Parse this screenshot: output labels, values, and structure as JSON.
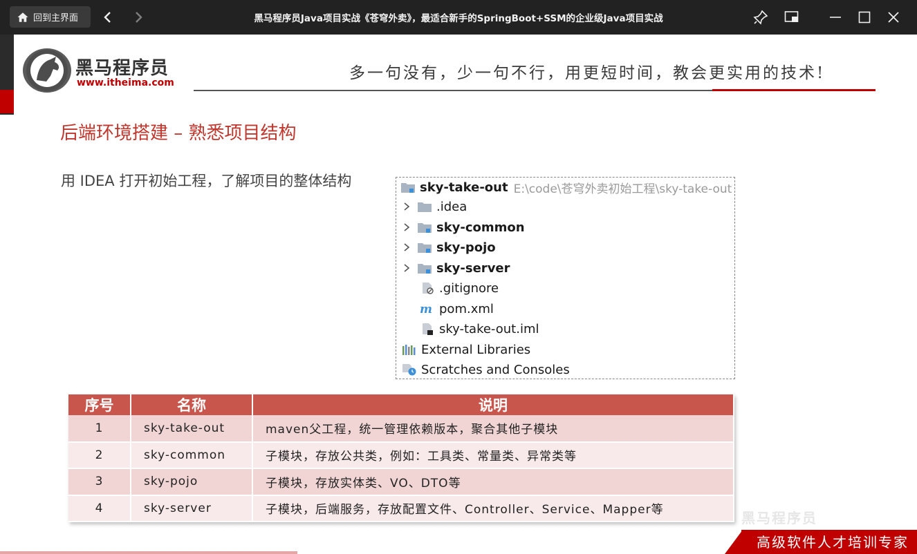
{
  "titlebar": {
    "home_label": "回到主界面",
    "title": "黑马程序员Java项目实战《苍穹外卖》，最适合新手的SpringBoot+SSM的企业级Java项目实战"
  },
  "slide": {
    "logo_cn": "黑马程序员",
    "logo_url": "www.itheima.com",
    "slogan": "多一句没有，少一句不行，用更短时间，教会更实用的技术!",
    "heading": "后端环境搭建 – 熟悉项目结构",
    "intro": "用 IDEA 打开初始工程，了解项目的整体结构",
    "tree": {
      "root_name": "sky-take-out",
      "root_path": "E:\\code\\苍穹外卖初始工程\\sky-take-out",
      "items": [
        {
          "label": ".idea"
        },
        {
          "label": "sky-common"
        },
        {
          "label": "sky-pojo"
        },
        {
          "label": "sky-server"
        },
        {
          "label": ".gitignore"
        },
        {
          "label": "pom.xml"
        },
        {
          "label": "sky-take-out.iml"
        },
        {
          "label": "External Libraries"
        },
        {
          "label": "Scratches and Consoles"
        }
      ]
    },
    "table": {
      "headers": [
        "序号",
        "名称",
        "说明"
      ],
      "rows": [
        [
          "1",
          "sky-take-out",
          "maven父工程，统一管理依赖版本，聚合其他子模块"
        ],
        [
          "2",
          "sky-common",
          "子模块，存放公共类，例如：工具类、常量类、异常类等"
        ],
        [
          "3",
          "sky-pojo",
          "子模块，存放实体类、VO、DTO等"
        ],
        [
          "4",
          "sky-server",
          "子模块，后端服务，存放配置文件、Controller、Service、Mapper等"
        ]
      ]
    },
    "footer_slogan": "高级软件人才培训专家",
    "watermark": "黑马程序员"
  }
}
